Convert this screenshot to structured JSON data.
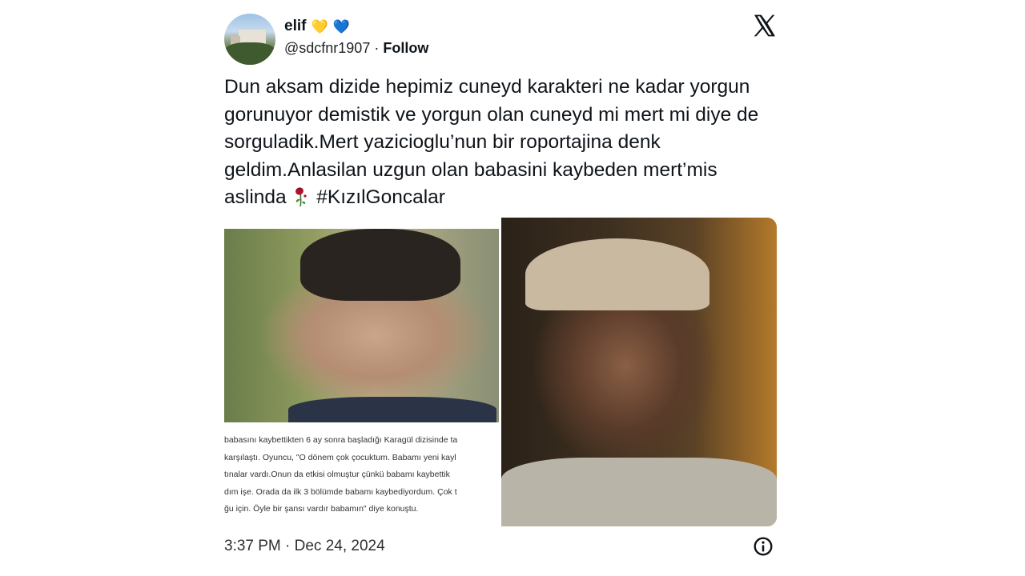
{
  "author": {
    "name": "elif",
    "hearts": [
      "💛",
      "💙"
    ],
    "handle": "@sdcfnr1907",
    "separator": "·",
    "follow_label": "Follow"
  },
  "header_icon": "x-logo-icon",
  "tweet": {
    "text": "Dun aksam dizide hepimiz cuneyd karakteri ne kadar yorgun gorunuyor demistik ve yorgun olan cuneyd mi mert mi diye de sorguladik.Mert yazicioglu’nun bir roportajina denk geldim.Anlasilan uzgun olan babasini kaybeden mert’mis aslinda",
    "emoji_icon": "wilted-rose-icon",
    "hashtag": "#KızılGoncalar"
  },
  "media": {
    "left_caption_lines": [
      "babasını kaybettikten 6 ay sonra başladığı Karagül dizisinde ta",
      "karşılaştı. Oyuncu, \"O dönem çok çocuktum. Babamı yeni kayl",
      "tınalar vardı.Onun da etkisi olmuştur çünkü babamı kaybettik",
      "dım işe. Orada da ilk 3 bölümde babamı kaybediyordum. Çok t",
      "ğu için. Öyle bir şansı vardır babamın\" diye konuştu."
    ]
  },
  "footer": {
    "timestamp": "3:37 PM · Dec 24, 2024",
    "info_icon": "info-icon"
  }
}
